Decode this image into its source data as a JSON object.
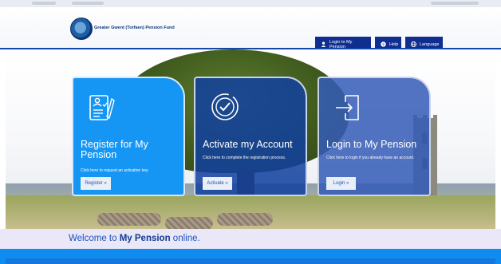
{
  "header": {
    "org_name": "Greater Gwent (Torfaen) Pension Fund",
    "nav": [
      {
        "label": "Login to My Pension",
        "icon": "user-icon"
      },
      {
        "label": "Help",
        "icon": "help-icon"
      },
      {
        "label": "Language",
        "icon": "globe-icon"
      }
    ]
  },
  "cards": [
    {
      "title": "Register for My Pension",
      "text": "Click here to request an activation key.",
      "button": "Register »",
      "icon": "form-checklist-icon"
    },
    {
      "title": "Activate my Account",
      "text": "Click here to complete the registration process.",
      "button": "Activate »",
      "icon": "check-circle-icon"
    },
    {
      "title": "Login to My Pension",
      "text": "Click here to login if you already have an account.",
      "button": "Login »",
      "icon": "door-enter-icon"
    }
  ],
  "welcome": {
    "prefix": "Welcome to ",
    "strong": "My Pension",
    "suffix": " online."
  },
  "colors": {
    "navy": "#0f2e8f",
    "bright_blue": "#1596f5",
    "welcome_bg": "#e9e7f8",
    "footer": "#0e8cf0"
  }
}
